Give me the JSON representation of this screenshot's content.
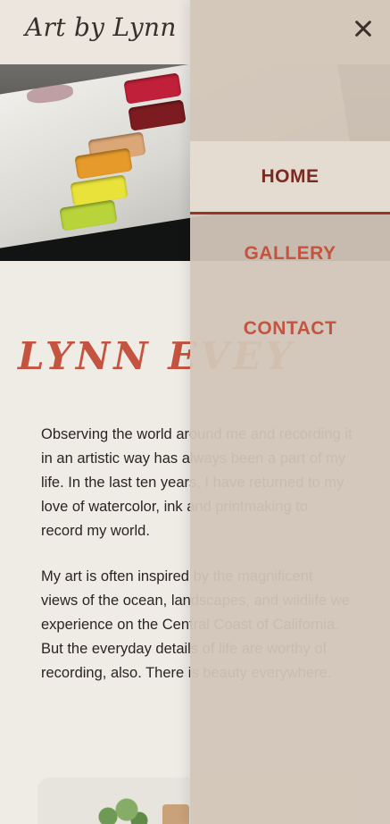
{
  "site": {
    "logo_text": "Art by Lynn"
  },
  "menu": {
    "close_icon": "close-icon",
    "items": [
      {
        "label": "HOME",
        "active": true
      },
      {
        "label": "GALLERY",
        "active": false
      },
      {
        "label": "CONTACT",
        "active": false
      }
    ]
  },
  "main": {
    "title": "LYNN EVEY",
    "paragraphs": [
      "Observing the world around me and recording it in an artistic way has always been a part of my life. In the last ten years, I have returned to my love of watercolor, ink and printmaking to record my world.",
      "My art is often inspired by the magnificent views of the ocean, landscapes, and wildlife we experience on the Central Coast of California. But the everyday details of life are worthy of recording, also. There is beauty everywhere."
    ]
  },
  "colors": {
    "accent": "#c4533f",
    "active_nav": "#7a2a22",
    "background": "#efebe5",
    "menu_overlay": "#d1c6b8"
  }
}
